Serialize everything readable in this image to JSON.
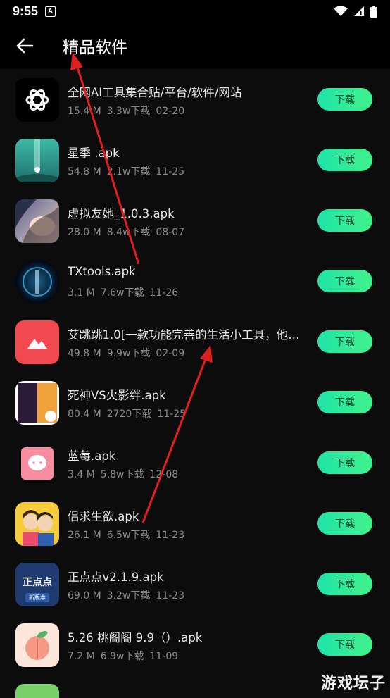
{
  "status": {
    "time": "9:55",
    "notif_letter": "A"
  },
  "header": {
    "title": "精品软件"
  },
  "download_label": "下载",
  "apps": [
    {
      "name": "全网AI工具集合贴/平台/软件/网站",
      "size": "15.4 M",
      "downloads": "3.3w下载",
      "date": "02-20",
      "icon": "openai-logo-icon"
    },
    {
      "name": "星季 .apk",
      "size": "54.8 M",
      "downloads": "2.1w下载",
      "date": "11-25",
      "icon": "starry-light-icon"
    },
    {
      "name": "虚拟友她_1.0.3.apk",
      "size": "28.0 M",
      "downloads": "8.4w下载",
      "date": "08-07",
      "icon": "girl-portrait-icon"
    },
    {
      "name": "TXtools.apk",
      "size": "3.1 M",
      "downloads": "7.6w下载",
      "date": "11-26",
      "icon": "neon-tool-icon"
    },
    {
      "name": "艾跳跳1.0[一款功能完善的生活小工具，他…",
      "size": "49.8 M",
      "downloads": "9.9w下载",
      "date": "02-09",
      "icon": "mountain-icon"
    },
    {
      "name": "死神VS火影绊.apk",
      "size": "80.4 M",
      "downloads": "2720下载",
      "date": "11-25",
      "icon": "anime-fighters-icon"
    },
    {
      "name": "蓝莓.apk",
      "size": "3.4 M",
      "downloads": "5.8w下载",
      "date": "12-08",
      "icon": "chat-bubble-icon"
    },
    {
      "name": "侣求生欲.apk",
      "size": "26.1 M",
      "downloads": "6.5w下载",
      "date": "11-23",
      "icon": "couple-cartoon-icon"
    },
    {
      "name": "正点点v2.1.9.apk",
      "size": "69.0 M",
      "downloads": "3.2w下载",
      "date": "11-23",
      "icon": "zhengdiandian-icon",
      "icon_text": "正点点",
      "icon_sub": "新版本"
    },
    {
      "name": "5.26 桃阁阁 9.9（）.apk",
      "size": "7.2 M",
      "downloads": "6.9w下载",
      "date": "11-09",
      "icon": "peach-icon"
    }
  ],
  "watermark": "游戏坛子",
  "colors": {
    "button_gradient_start": "#1ee3a8",
    "button_gradient_end": "#40f28a",
    "background": "#0c0c0c",
    "arrow": "#e02020"
  }
}
